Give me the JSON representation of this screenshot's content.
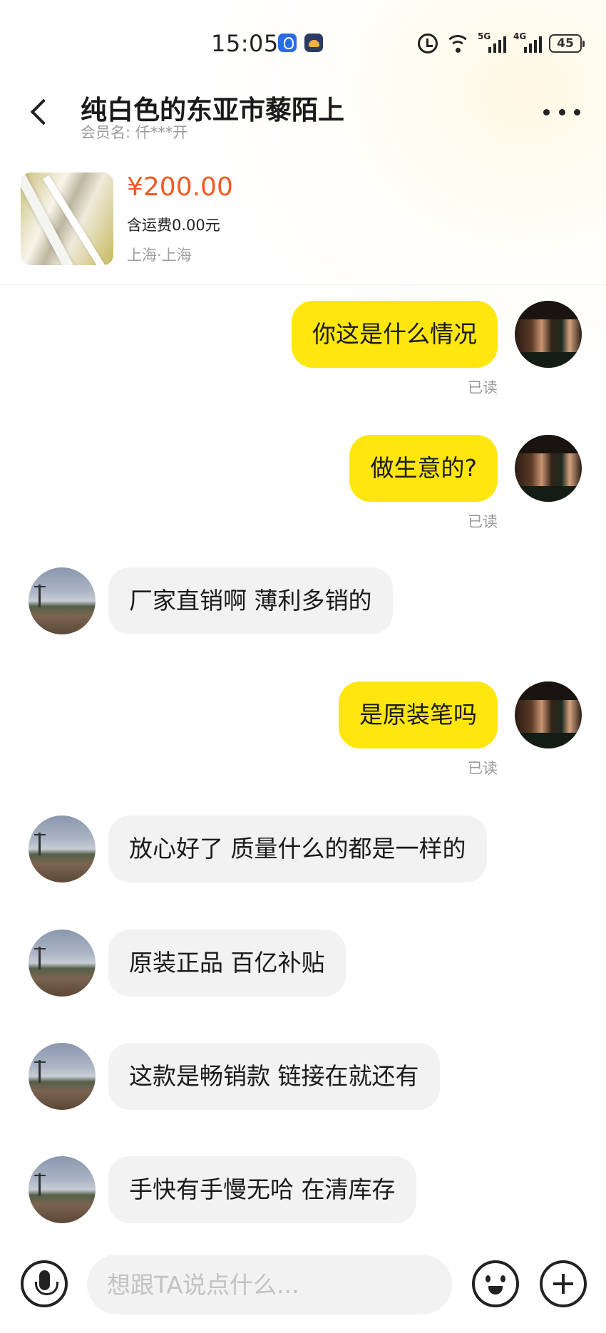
{
  "status_bar": {
    "time": "15:05",
    "signal_1": "5G",
    "signal_2": "4G",
    "battery": "45"
  },
  "header": {
    "title": "纯白色的东亚市藜陌上",
    "member_label": "会员名:",
    "member_name": "仟***开"
  },
  "product": {
    "price": "¥200.00",
    "shipping": "含运费0.00元",
    "location": "上海·上海"
  },
  "messages": [
    {
      "side": "out",
      "text": "你这是什么情况",
      "status": "已读"
    },
    {
      "side": "out",
      "text": "做生意的?",
      "status": "已读"
    },
    {
      "side": "in",
      "text": "厂家直销啊 薄利多销的"
    },
    {
      "side": "out",
      "text": "是原装笔吗",
      "status": "已读"
    },
    {
      "side": "in",
      "text": "放心好了 质量什么的都是一样的"
    },
    {
      "side": "in",
      "text": "原装正品 百亿补贴"
    },
    {
      "side": "in",
      "text": "这款是畅销款 链接在就还有"
    },
    {
      "side": "in",
      "text": "手快有手慢无哈 在清库存"
    }
  ],
  "input": {
    "placeholder": "想跟TA说点什么..."
  },
  "colors": {
    "outgoing_bubble": "#ffe60f",
    "incoming_bubble": "#f2f2f3",
    "price": "#f25a22"
  }
}
